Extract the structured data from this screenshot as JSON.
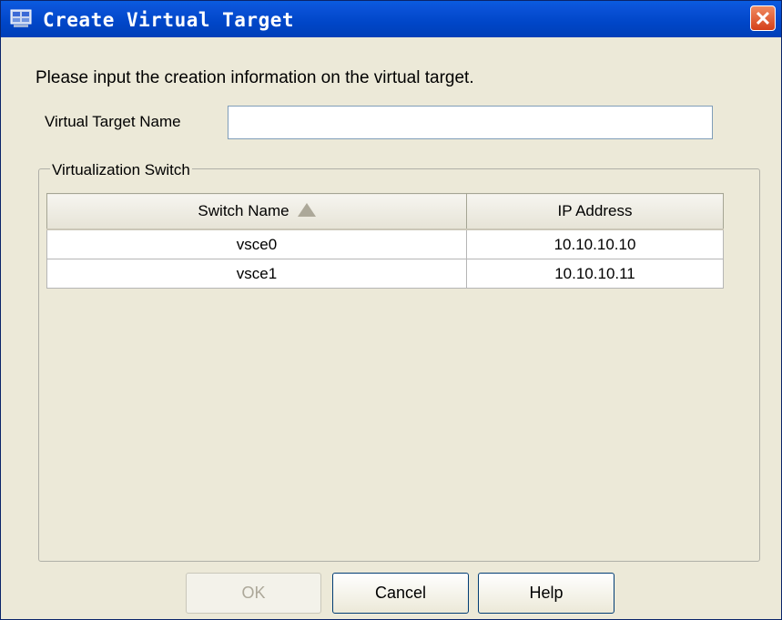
{
  "window": {
    "title": "Create Virtual Target",
    "close_label": "✕"
  },
  "instruction": "Please input the creation information on the virtual target.",
  "form": {
    "name_label": "Virtual Target Name",
    "name_value": "",
    "name_placeholder": ""
  },
  "group": {
    "legend": "Virtualization Switch",
    "columns": [
      "Switch Name",
      "IP Address"
    ],
    "sort_column": "Switch Name",
    "sort_direction": "ascending",
    "rows": [
      {
        "switch_name": "vsce0",
        "ip_address": "10.10.10.10"
      },
      {
        "switch_name": "vsce1",
        "ip_address": "10.10.10.11"
      }
    ]
  },
  "buttons": {
    "ok": "OK",
    "cancel": "Cancel",
    "help": "Help",
    "ok_enabled": false
  },
  "colors": {
    "titlebar": "#0046c8",
    "dialog_bg": "#ece9d8",
    "close_button": "#d4401a"
  }
}
